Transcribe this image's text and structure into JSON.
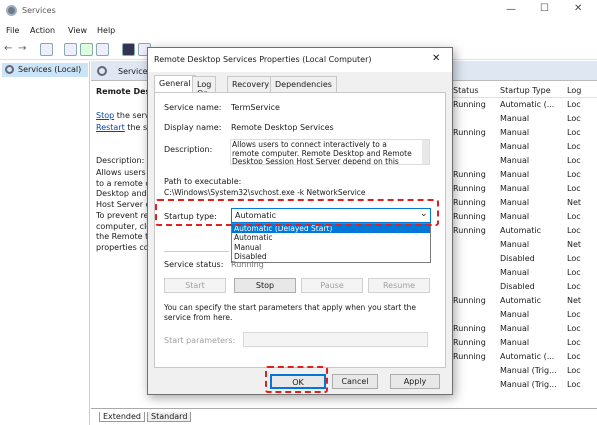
{
  "window": {
    "title": "Services",
    "minimize": "—",
    "maximize": "☐",
    "close": "✕"
  },
  "menu": [
    "File",
    "Action",
    "View",
    "Help"
  ],
  "left_panel": {
    "item": "Services (Local)"
  },
  "bg_header": "Service",
  "bg_left": {
    "title": "Remote Desk",
    "stop_link": "Stop",
    "stop_rest": " the serv",
    "restart_link": "Restart",
    "restart_rest": " the se",
    "desc_label": "Description:",
    "desc_lines": [
      "Allows users",
      "to a remote c",
      "Desktop and",
      "Host Server c",
      "To prevent re",
      "computer, cle",
      "the Remote t",
      "properties co"
    ]
  },
  "columns": {
    "status": "Status",
    "startup": "Startup Type",
    "logon": "Log"
  },
  "rows": [
    {
      "status": "Running",
      "startup": "Automatic (...",
      "logon": "Loc"
    },
    {
      "status": "",
      "startup": "Manual",
      "logon": "Loc"
    },
    {
      "status": "Running",
      "startup": "Manual",
      "logon": "Loc"
    },
    {
      "status": "",
      "startup": "Manual",
      "logon": "Loc"
    },
    {
      "status": "",
      "startup": "Manual",
      "logon": "Loc"
    },
    {
      "status": "Running",
      "startup": "Manual",
      "logon": "Loc"
    },
    {
      "status": "Running",
      "startup": "Manual",
      "logon": "Loc"
    },
    {
      "status": "Running",
      "startup": "Manual",
      "logon": "Net"
    },
    {
      "status": "Running",
      "startup": "Manual",
      "logon": "Loc"
    },
    {
      "status": "Running",
      "startup": "Automatic",
      "logon": "Loc"
    },
    {
      "status": "",
      "startup": "Manual",
      "logon": "Net"
    },
    {
      "status": "",
      "startup": "Disabled",
      "logon": "Loc"
    },
    {
      "status": "",
      "startup": "Manual",
      "logon": "Loc"
    },
    {
      "status": "",
      "startup": "Disabled",
      "logon": "Loc"
    },
    {
      "status": "Running",
      "startup": "Automatic",
      "logon": "Net"
    },
    {
      "status": "",
      "startup": "Manual",
      "logon": "Loc"
    },
    {
      "status": "Running",
      "startup": "Manual",
      "logon": "Loc"
    },
    {
      "status": "Running",
      "startup": "Manual",
      "logon": "Loc"
    },
    {
      "status": "Running",
      "startup": "Automatic (...",
      "logon": "Loc"
    },
    {
      "status": "",
      "startup": "Manual (Trig...",
      "logon": "Loc"
    },
    {
      "status": "",
      "startup": "Manual (Trig...",
      "logon": "Loc"
    }
  ],
  "bottom_tabs": [
    "Extended",
    "Standard"
  ],
  "dialog": {
    "title": "Remote Desktop Services Properties (Local Computer)",
    "tabs": [
      "General",
      "Log On",
      "Recovery",
      "Dependencies"
    ],
    "service_name_label": "Service name:",
    "service_name": "TermService",
    "display_name_label": "Display name:",
    "display_name": "Remote Desktop Services",
    "description_label": "Description:",
    "description": "Allows users to connect interactively to a remote computer. Remote Desktop and Remote Desktop Session Host Server depend on this service. To",
    "path_label": "Path to executable:",
    "path": "C:\\Windows\\System32\\svchost.exe -k NetworkService",
    "startup_label": "Startup type:",
    "startup_value": "Automatic",
    "startup_options": [
      "Automatic (Delayed Start)",
      "Automatic",
      "Manual",
      "Disabled"
    ],
    "status_label": "Service status:",
    "status_value": "Running",
    "buttons": {
      "start": "Start",
      "stop": "Stop",
      "pause": "Pause",
      "resume": "Resume"
    },
    "hint": "You can specify the start parameters that apply when you start the service from here.",
    "params_label": "Start parameters:",
    "ok": "OK",
    "cancel": "Cancel",
    "apply": "Apply",
    "close": "✕"
  },
  "colors": {
    "highlight": "#e02020",
    "accent": "#0078d7"
  }
}
